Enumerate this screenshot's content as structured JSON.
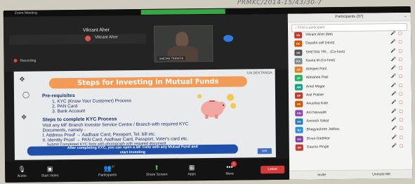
{
  "handwritten_note": "PRMKC/2014-15/43/30-7",
  "window": {
    "title": "Zoom Meeting",
    "share_banner": "You are viewing ... screen",
    "recording": "Recording"
  },
  "host": {
    "name": "Vikrant Aher",
    "tile_name": "Vikrant Aher",
    "camera_label": "SHETAN TRIPATHI"
  },
  "slide": {
    "tag": "UN DEKTANGA",
    "title": "Steps for Investing in Mutual Funds",
    "prereq_title": "Pre-requisites",
    "prereq": [
      "1. KYC (Know Your Customer) Process",
      "2. PAN Card",
      "3. Bank Account"
    ],
    "steps_title": "Steps to complete KYC Process",
    "steps": [
      "Visit any MF Branch Investor Service Centre / Branch with required KYC",
      "Documents, namely -",
      "I.   Address Proof → Aadhaar Card, Passport, Tel. bill etc.",
      "II.  Identity Proof → PAN Card, Aadhaar Card, Passport, Voter's card etc.",
      "Submit Completed KYC form with photograph with required document"
    ],
    "footer_line1": "After completing KYC, you can open a MF Folio with any Mutual Fund and",
    "footer_line2": "start investing",
    "corner_mark": "MSI"
  },
  "toolbar": {
    "audio": "Audio",
    "video": "Start Video",
    "participants": "Participants",
    "participants_count": "37",
    "share": "Share Screen",
    "apps": "Apps",
    "more": "More",
    "more_badge": "1",
    "leave": "Leave"
  },
  "panel": {
    "title": "Participants (37)",
    "search_placeholder": "Find a participant",
    "invite": "Invite",
    "unmute": "Unmute Me",
    "participants": [
      {
        "initials": "VA",
        "name": "Vikrant Aher (Me)",
        "color": "#c0392b"
      },
      {
        "initials": "DC",
        "name": "Dayahri cell (Host)",
        "color": "#d35400"
      },
      {
        "initials": "SS",
        "name": "SHETAN TRI... (Co-host)",
        "color": "#555555"
      },
      {
        "initials": "KA",
        "name": "Kavita M (Co-host)",
        "color": "#7f8c8d"
      },
      {
        "initials": "AP",
        "name": "Abhijeet Patil",
        "color": "#e67e22"
      },
      {
        "initials": "AP",
        "name": "Abhishek Patil",
        "color": "#27ae60"
      },
      {
        "initials": "AM",
        "name": "Amol Magar",
        "color": "#16a085"
      },
      {
        "initials": "AP",
        "name": "Anil Pokhle",
        "color": "#c0392b"
      },
      {
        "initials": "AK",
        "name": "Anushka Kale",
        "color": "#d35400"
      },
      {
        "initials": "AN",
        "name": "Arti Narwade",
        "color": "#8e44ad"
      },
      {
        "initials": "AS",
        "name": "Avinash Sakat",
        "color": "#2980b9"
      },
      {
        "initials": "BJ",
        "name": "Bhagyashree Jadhav",
        "color": "#2c8fd8"
      },
      {
        "initials": "DG",
        "name": "Divya Gadekar",
        "color": "#7d3c98"
      },
      {
        "initials": "GP",
        "name": "Gaurav Pingle",
        "color": "#c0392b"
      }
    ]
  },
  "colors": {
    "banner": "#f39a57",
    "footer": "#1f4fa8",
    "leave": "#d43a3a",
    "share": "#3ec14b"
  }
}
